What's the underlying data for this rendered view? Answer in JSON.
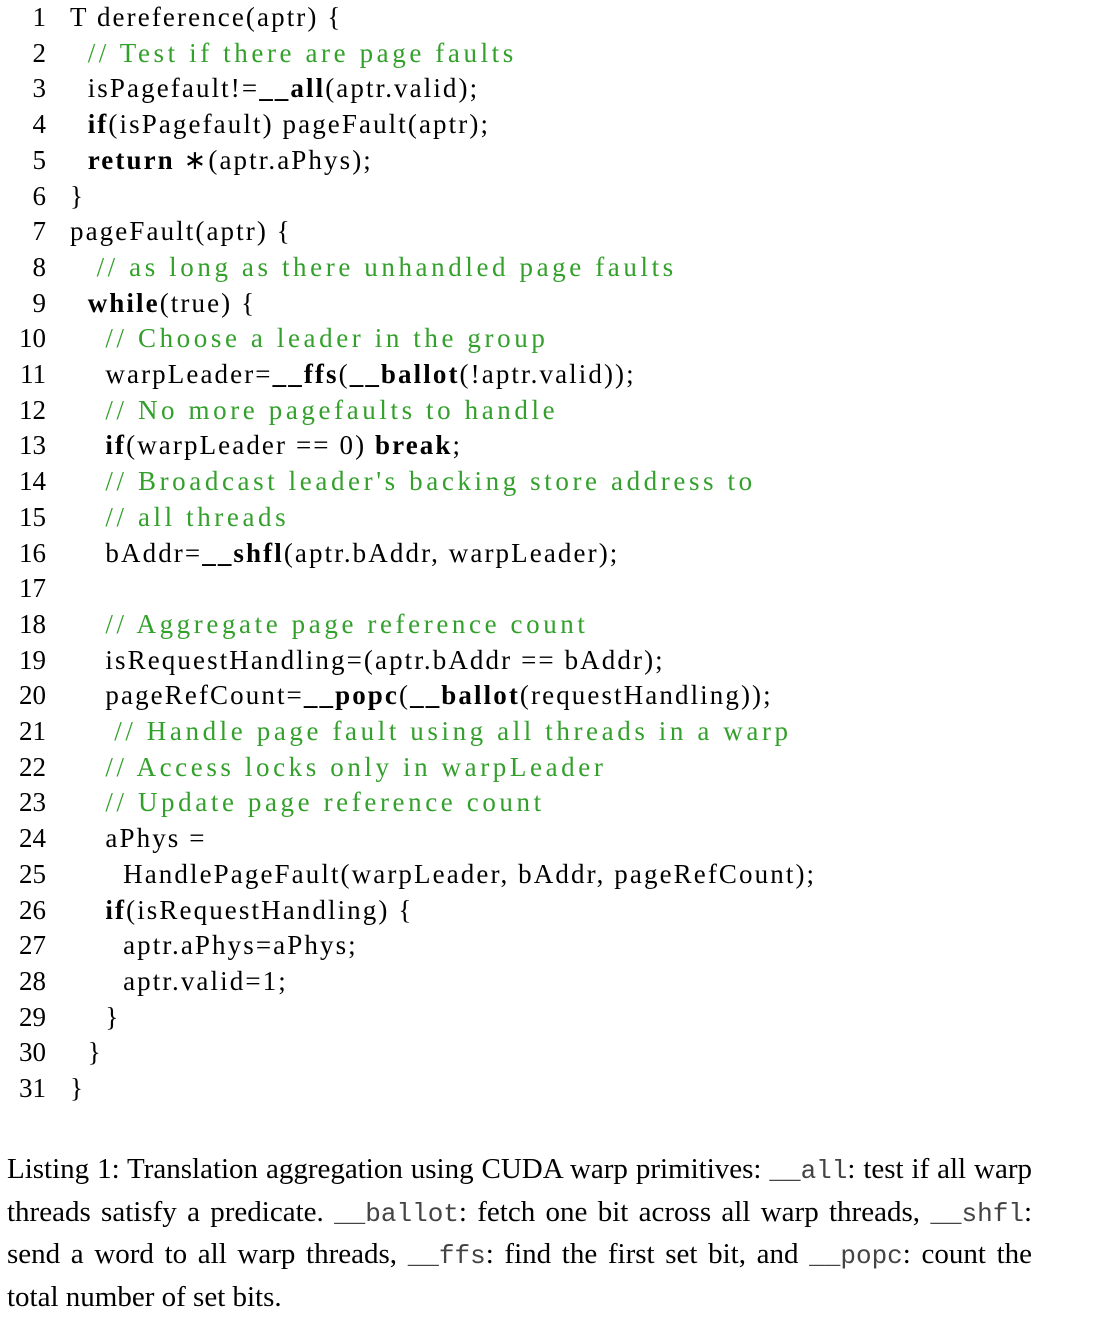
{
  "listing": {
    "lines": [
      {
        "n": "1",
        "segs": [
          {
            "t": "T dereference(aptr) {"
          }
        ]
      },
      {
        "n": "2",
        "segs": [
          {
            "t": "  "
          },
          {
            "t": "// Test if there are page faults",
            "k": "cm"
          }
        ]
      },
      {
        "n": "3",
        "segs": [
          {
            "t": "  isPagefault!="
          },
          {
            "t": "__all",
            "k": "b"
          },
          {
            "t": "(aptr.valid);"
          }
        ]
      },
      {
        "n": "4",
        "segs": [
          {
            "t": "  "
          },
          {
            "t": "if",
            "k": "b"
          },
          {
            "t": "(isPagefault) pageFault(aptr);"
          }
        ]
      },
      {
        "n": "5",
        "segs": [
          {
            "t": "  "
          },
          {
            "t": "return",
            "k": "b"
          },
          {
            "t": " ∗(aptr.aPhys);"
          }
        ]
      },
      {
        "n": "6",
        "segs": [
          {
            "t": "}"
          }
        ]
      },
      {
        "n": "7",
        "segs": [
          {
            "t": "pageFault(aptr) {"
          }
        ]
      },
      {
        "n": "8",
        "segs": [
          {
            "t": "   "
          },
          {
            "t": "// as long as there unhandled page faults",
            "k": "cm"
          }
        ]
      },
      {
        "n": "9",
        "segs": [
          {
            "t": "  "
          },
          {
            "t": "while",
            "k": "b"
          },
          {
            "t": "(true) {"
          }
        ]
      },
      {
        "n": "10",
        "segs": [
          {
            "t": "    "
          },
          {
            "t": "// Choose a leader in the group",
            "k": "cm"
          }
        ]
      },
      {
        "n": "11",
        "segs": [
          {
            "t": "    warpLeader="
          },
          {
            "t": "__ffs",
            "k": "b"
          },
          {
            "t": "("
          },
          {
            "t": "__ballot",
            "k": "b"
          },
          {
            "t": "(!aptr.valid));"
          }
        ]
      },
      {
        "n": "12",
        "segs": [
          {
            "t": "    "
          },
          {
            "t": "// No more pagefaults to handle",
            "k": "cm"
          }
        ]
      },
      {
        "n": "13",
        "segs": [
          {
            "t": "    "
          },
          {
            "t": "if",
            "k": "b"
          },
          {
            "t": "(warpLeader == 0) "
          },
          {
            "t": "break",
            "k": "b"
          },
          {
            "t": ";"
          }
        ]
      },
      {
        "n": "14",
        "segs": [
          {
            "t": "    "
          },
          {
            "t": "// Broadcast leader's backing store address to",
            "k": "cm"
          }
        ]
      },
      {
        "n": "15",
        "segs": [
          {
            "t": "    "
          },
          {
            "t": "// all threads",
            "k": "cm"
          }
        ]
      },
      {
        "n": "16",
        "segs": [
          {
            "t": "    bAddr="
          },
          {
            "t": "__shfl",
            "k": "b"
          },
          {
            "t": "(aptr.bAddr, warpLeader);"
          }
        ]
      },
      {
        "n": "17",
        "segs": []
      },
      {
        "n": "18",
        "segs": [
          {
            "t": "    "
          },
          {
            "t": "// Aggregate page reference count",
            "k": "cm"
          }
        ]
      },
      {
        "n": "19",
        "segs": [
          {
            "t": "    isRequestHandling=(aptr.bAddr == bAddr);"
          }
        ]
      },
      {
        "n": "20",
        "segs": [
          {
            "t": "    pageRefCount="
          },
          {
            "t": "__popc",
            "k": "b"
          },
          {
            "t": "("
          },
          {
            "t": "__ballot",
            "k": "b"
          },
          {
            "t": "(requestHandling));"
          }
        ]
      },
      {
        "n": "21",
        "segs": [
          {
            "t": "     "
          },
          {
            "t": "// Handle page fault using all threads in a warp",
            "k": "cm"
          }
        ]
      },
      {
        "n": "22",
        "segs": [
          {
            "t": "    "
          },
          {
            "t": "// Access locks only in warpLeader",
            "k": "cm"
          }
        ]
      },
      {
        "n": "23",
        "segs": [
          {
            "t": "    "
          },
          {
            "t": "// Update page reference count",
            "k": "cm"
          }
        ]
      },
      {
        "n": "24",
        "segs": [
          {
            "t": "    aPhys ="
          }
        ]
      },
      {
        "n": "25",
        "segs": [
          {
            "t": "      HandlePageFault(warpLeader, bAddr, pageRefCount);"
          }
        ]
      },
      {
        "n": "26",
        "segs": [
          {
            "t": "    "
          },
          {
            "t": "if",
            "k": "b"
          },
          {
            "t": "(isRequestHandling) {"
          }
        ]
      },
      {
        "n": "27",
        "segs": [
          {
            "t": "      aptr.aPhys=aPhys;"
          }
        ]
      },
      {
        "n": "28",
        "segs": [
          {
            "t": "      aptr.valid=1;"
          }
        ]
      },
      {
        "n": "29",
        "segs": [
          {
            "t": "    }"
          }
        ]
      },
      {
        "n": "30",
        "segs": [
          {
            "t": "  }"
          }
        ]
      },
      {
        "n": "31",
        "segs": [
          {
            "t": "}"
          }
        ]
      }
    ],
    "offsets": {
      "8": "  ",
      "21": "  "
    }
  },
  "caption": {
    "prefix": "Listing 1: Translation aggregation using CUDA warp primitives: ",
    "all_name": "__all",
    "all_desc": ": test if all warp threads satisfy a predicate. ",
    "ballot_name": "__ballot",
    "ballot_desc": ": fetch one bit across all warp threads, ",
    "shfl_name": "__shfl",
    "shfl_desc": ": send a word to all warp threads, ",
    "ffs_name": "__ffs",
    "ffs_desc": ": find the first set bit, and ",
    "popc_name": "__popc",
    "popc_desc": ": count the total number of set bits."
  }
}
